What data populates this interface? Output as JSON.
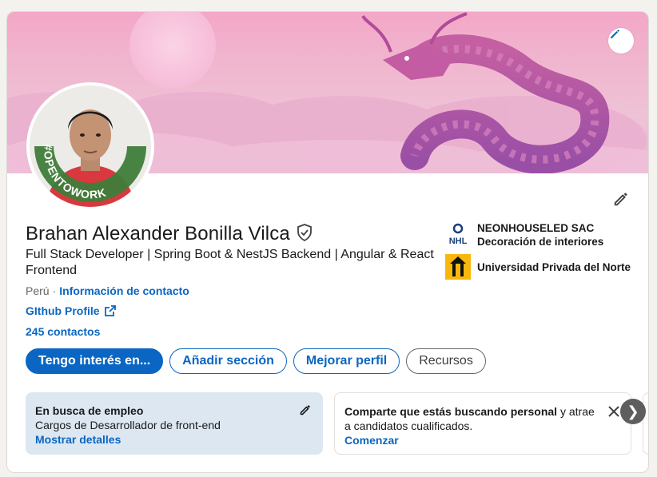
{
  "profile": {
    "name": "Brahan Alexander Bonilla Vilca",
    "headline": "Full Stack Developer | Spring Boot & NestJS Backend | Angular & React Frontend",
    "location": "Perú",
    "location_separator": "·",
    "contact_info_label": "Información de contacto",
    "github_label": "GIthub Profile",
    "connections": "245 contactos",
    "open_to_work_badge": "#OPENTOWORK"
  },
  "companies": [
    {
      "logo_text": "NHL",
      "name": "NEONHOUSELED SAC",
      "subtitle": "Decoración de interiores"
    },
    {
      "logo_text": "",
      "name": "Universidad Privada del Norte",
      "subtitle": ""
    }
  ],
  "actions": {
    "primary": "Tengo interés en...",
    "add_section": "Añadir sección",
    "improve_profile": "Mejorar perfil",
    "resources": "Recursos"
  },
  "open_to_work_card": {
    "title": "En busca de empleo",
    "roles": "Cargos de Desarrollador de front-end",
    "show_details": "Mostrar detalles"
  },
  "hiring_card": {
    "text_bold": "Comparte que estás buscando personal",
    "text_rest": " y atrae a candidatos cualificados.",
    "cta": "Comenzar"
  },
  "colors": {
    "primary": "#0a66c2",
    "open_to_work_green": "#3f7d3a",
    "card_bg": "#dde7f1"
  },
  "icons": [
    "pencil-icon",
    "verified-shield-icon",
    "external-link-icon",
    "close-icon",
    "chevron-right-icon"
  ]
}
